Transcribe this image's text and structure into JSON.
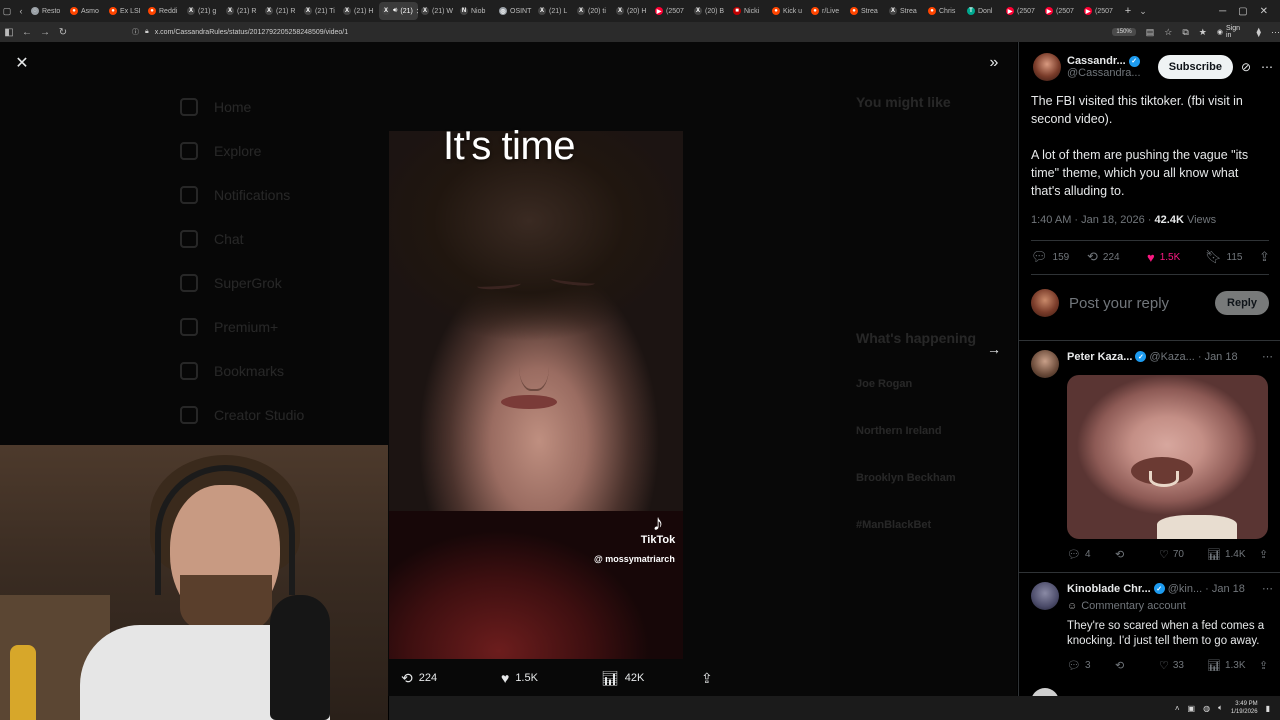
{
  "browser": {
    "tabs": [
      {
        "label": "Resto",
        "icon": "circle-icon",
        "color": "#9aa0a6"
      },
      {
        "label": "Asmo",
        "icon": "reddit-icon",
        "color": "#ff4500"
      },
      {
        "label": "Ex LSI",
        "icon": "reddit-icon",
        "color": "#ff4500"
      },
      {
        "label": "Reddi",
        "icon": "reddit-icon",
        "color": "#ff4500"
      },
      {
        "label": "(21) g",
        "icon": "x-icon",
        "color": "#444444"
      },
      {
        "label": "(21) R",
        "icon": "x-icon",
        "color": "#444444"
      },
      {
        "label": "(21) R",
        "icon": "x-icon",
        "color": "#444444"
      },
      {
        "label": "(21) Ti",
        "icon": "x-icon",
        "color": "#444444"
      },
      {
        "label": "(21) H",
        "icon": "x-icon",
        "color": "#444444"
      },
      {
        "label": "(21)",
        "icon": "x-icon",
        "color": "#444444",
        "active": true
      },
      {
        "label": "(21) W",
        "icon": "x-icon",
        "color": "#444444"
      },
      {
        "label": "Niob",
        "icon": "n-icon",
        "color": "#444444"
      },
      {
        "label": "OSINT",
        "icon": "globe-icon",
        "color": "#9aa0a6"
      },
      {
        "label": "(21) L",
        "icon": "x-icon",
        "color": "#444444"
      },
      {
        "label": "(20) ti",
        "icon": "x-icon",
        "color": "#444444"
      },
      {
        "label": "(20) H",
        "icon": "x-icon",
        "color": "#444444"
      },
      {
        "label": "(2507",
        "icon": "youtube-icon",
        "color": "#ff0033"
      },
      {
        "label": "(20) B",
        "icon": "x-icon",
        "color": "#444444"
      },
      {
        "label": "Nicki",
        "icon": "media-icon",
        "color": "#c00000"
      },
      {
        "label": "Kick u",
        "icon": "reddit-icon",
        "color": "#ff4500"
      },
      {
        "label": "r/Live",
        "icon": "reddit-icon",
        "color": "#ff4500"
      },
      {
        "label": "Strea",
        "icon": "reddit-icon",
        "color": "#ff4500"
      },
      {
        "label": "Strea",
        "icon": "x-icon",
        "color": "#444444"
      },
      {
        "label": "Chris",
        "icon": "reddit-icon",
        "color": "#ff4500"
      },
      {
        "label": "Donl",
        "icon": "tt-icon",
        "color": "#00a88f"
      },
      {
        "label": "(2507",
        "icon": "youtube-icon",
        "color": "#ff0033"
      },
      {
        "label": "(2507",
        "icon": "youtube-icon",
        "color": "#ff0033"
      },
      {
        "label": "(2507",
        "icon": "youtube-icon",
        "color": "#ff0033"
      }
    ],
    "url": "x.com/CassandraRules/status/2012792205258248509/video/1",
    "zoom": "150%",
    "signin_label": "Sign in"
  },
  "viewer": {
    "overlay_text": "It's time",
    "tiktok_label": "TikTok",
    "tiktok_handle": "@ mossymatriarch",
    "actions": {
      "reposts": "224",
      "likes": "1.5K",
      "views": "42K"
    },
    "background": {
      "nav": [
        "Home",
        "Explore",
        "Notifications",
        "Chat",
        "SuperGrok",
        "Premium+",
        "Bookmarks",
        "Creator Studio"
      ],
      "you_might_like": "You might like",
      "whats_happening": "What's happening",
      "trends": [
        "Joe Rogan",
        "Northern Ireland",
        "Brooklyn Beckham",
        "#ManBlackBet"
      ]
    }
  },
  "post": {
    "author_name": "Cassandr...",
    "author_handle": "@Cassandra...",
    "subscribe_label": "Subscribe",
    "body_p1": "The FBI visited this tiktoker. (fbi visit in second video).",
    "body_p2": "A lot of them are pushing the vague \"its time\" theme, which you all know what that's alluding to.",
    "time": "1:40 AM · Jan 18, 2026 · ",
    "views_count": "42.4K",
    "views_label": " Views",
    "stats": {
      "replies": "159",
      "reposts": "224",
      "likes": "1.5K",
      "bookmarks": "115"
    },
    "reply_placeholder": "Post your reply",
    "reply_button": "Reply",
    "like_color": "#f91880"
  },
  "comments": [
    {
      "name": "Peter Kaza...",
      "handle": "@Kaza...",
      "date": "· Jan 18",
      "stats": {
        "replies": "4",
        "reposts": "",
        "likes": "70",
        "views": "1.4K"
      }
    },
    {
      "name": "Kinoblade Chr...",
      "handle": "@kin...",
      "date": "· Jan 18",
      "badge": "Commentary account",
      "text": "They're so scared when a fed comes a knocking. I'd just tell them to go away.",
      "stats": {
        "replies": "3",
        "reposts": "",
        "likes": "33",
        "views": "1.3K"
      }
    }
  ],
  "taskbar": {
    "time": "3:49 PM",
    "date": "1/19/2026"
  },
  "accent": "#1d9bf0"
}
